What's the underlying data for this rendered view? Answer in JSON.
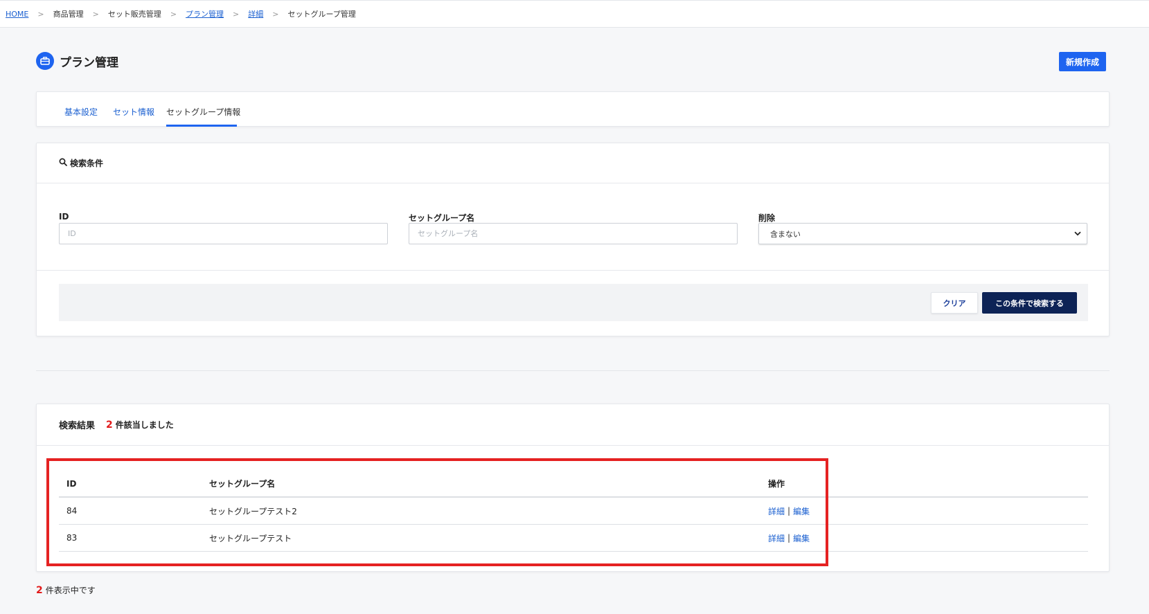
{
  "breadcrumb": [
    {
      "label": "HOME",
      "link": true
    },
    {
      "label": "商品管理",
      "link": false
    },
    {
      "label": "セット販売管理",
      "link": false
    },
    {
      "label": "プラン管理",
      "link": true
    },
    {
      "label": "詳細",
      "link": true
    },
    {
      "label": "セットグループ管理",
      "link": false
    }
  ],
  "breadcrumb_separator": ">",
  "page": {
    "title": "プラン管理",
    "new_button": "新規作成"
  },
  "tabs": [
    {
      "label": "基本設定",
      "active": false
    },
    {
      "label": "セット情報",
      "active": false
    },
    {
      "label": "セットグループ情報",
      "active": true
    }
  ],
  "search": {
    "header": "検索条件",
    "fields": {
      "id": {
        "label": "ID",
        "placeholder": "ID",
        "value": ""
      },
      "name": {
        "label": "セットグループ名",
        "placeholder": "セットグループ名",
        "value": ""
      },
      "deleted": {
        "label": "削除",
        "selected": "含まない"
      }
    },
    "clear_button": "クリア",
    "submit_button": "この条件で検索する"
  },
  "results": {
    "title": "検索結果",
    "count": "2",
    "count_suffix": "件該当しました",
    "columns": {
      "id": "ID",
      "name": "セットグループ名",
      "ops": "操作"
    },
    "rows": [
      {
        "id": "84",
        "name": "セットグループテスト2",
        "detail": "詳細",
        "sep": "|",
        "edit": "編集"
      },
      {
        "id": "83",
        "name": "セットグループテスト",
        "detail": "詳細",
        "sep": "|",
        "edit": "編集"
      }
    ]
  },
  "footer": {
    "count": "2",
    "text": "件表示中です"
  },
  "colors": {
    "accent": "#1e64f0",
    "dark_button": "#0d2356",
    "count_red": "#e21b1b",
    "highlight": "#e52222"
  }
}
